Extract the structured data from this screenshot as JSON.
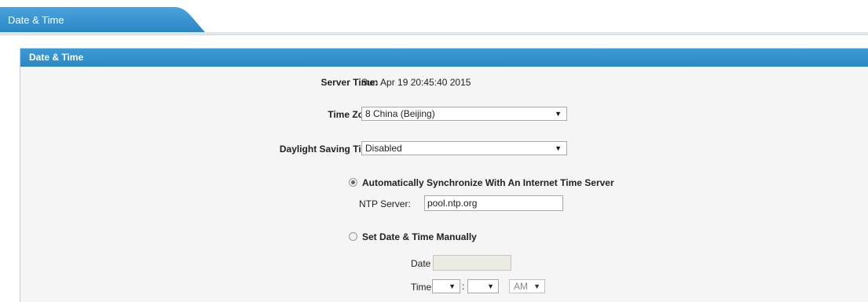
{
  "tab": {
    "label": "Date & Time"
  },
  "panel": {
    "title": "Date & Time"
  },
  "server_time": {
    "label": "Server Time:",
    "value": "Sun Apr 19 20:45:40 2015"
  },
  "time_zone": {
    "label": "Time Zone:",
    "value": "8 China (Beijing)"
  },
  "dst": {
    "label": "Daylight Saving Time:",
    "value": "Disabled"
  },
  "auto_sync": {
    "label": "Automatically Synchronize With An Internet Time Server",
    "checked": true,
    "ntp_label": "NTP Server:",
    "ntp_value": "pool.ntp.org"
  },
  "manual": {
    "label": "Set Date & Time Manually",
    "checked": false,
    "date_label": "Date",
    "date_value": "",
    "time_label": "Time",
    "time_separator": ":",
    "ampm_value": "AM"
  },
  "colors": {
    "accent": "#2b88c6",
    "panel_bg": "#f5f5f5"
  },
  "icons": {
    "select_arrow": "▼"
  }
}
